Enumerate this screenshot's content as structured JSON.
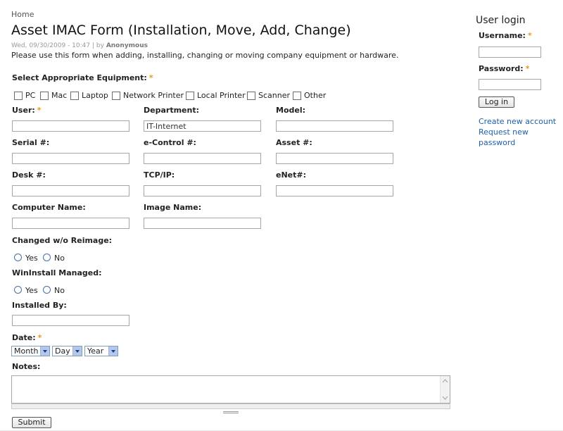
{
  "breadcrumb": "Home",
  "page_title": "Asset IMAC Form (Installation, Move, Add, Change)",
  "submitted": {
    "date": "Wed, 09/30/2009 - 10:47",
    "by_label": "by",
    "author": "Anonymous"
  },
  "intro": "Please use this form when adding, installing, changing or moving company equipment or hardware.",
  "required_mark": "*",
  "equipment": {
    "label": "Select Appropriate Equipment:",
    "options": [
      "PC",
      "Mac",
      "Laptop",
      "Network Printer",
      "Local Printer",
      "Scanner",
      "Other"
    ]
  },
  "fields": {
    "user": {
      "label": "User:",
      "value": ""
    },
    "department": {
      "label": "Department:",
      "value": "IT-Internet"
    },
    "model": {
      "label": "Model:",
      "value": ""
    },
    "serial": {
      "label": "Serial #:",
      "value": ""
    },
    "econtrol": {
      "label": "e-Control #:",
      "value": ""
    },
    "asset": {
      "label": "Asset #:",
      "value": ""
    },
    "desk": {
      "label": "Desk #:",
      "value": ""
    },
    "tcpip": {
      "label": "TCP/IP:",
      "value": ""
    },
    "enet": {
      "label": "eNet#:",
      "value": ""
    },
    "computer_name": {
      "label": "Computer Name:",
      "value": ""
    },
    "image_name": {
      "label": "Image Name:",
      "value": ""
    },
    "installed_by": {
      "label": "Installed By:",
      "value": ""
    }
  },
  "changed_reimage": {
    "label": "Changed w/o Reimage:",
    "yes": "Yes",
    "no": "No"
  },
  "wininstall": {
    "label": "WinInstall Managed:",
    "yes": "Yes",
    "no": "No"
  },
  "date": {
    "label": "Date:",
    "month": "Month",
    "day": "Day",
    "year": "Year"
  },
  "notes": {
    "label": "Notes:"
  },
  "submit_label": "Submit",
  "sidebar": {
    "title": "User login",
    "username_label": "Username:",
    "password_label": "Password:",
    "login_button": "Log in",
    "create_account": "Create new account",
    "request_password_line1": "Request new",
    "request_password_line2": "password"
  }
}
